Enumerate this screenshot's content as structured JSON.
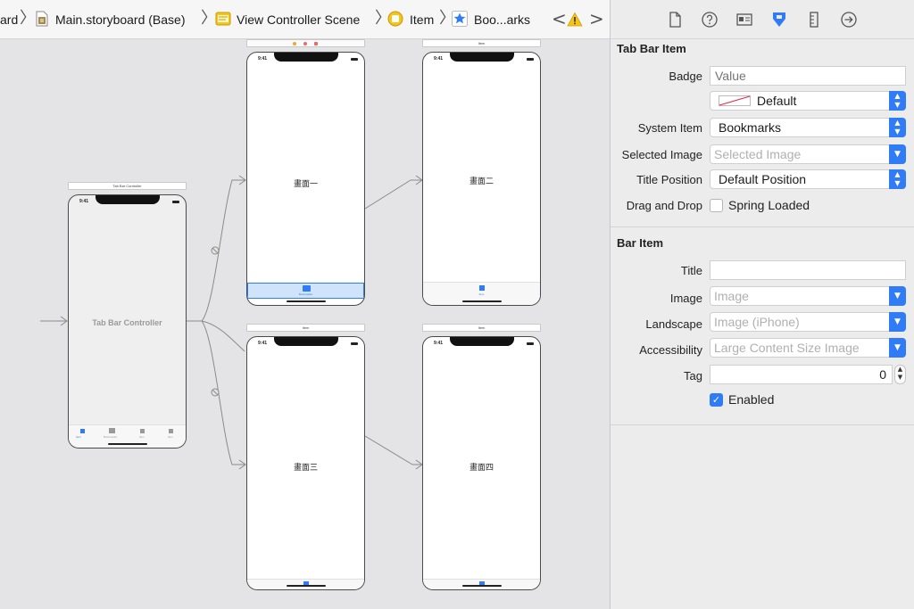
{
  "jumpbar": {
    "crumbs": [
      "ard",
      "Main.storyboard (Base)",
      "View Controller Scene",
      "Item",
      "Boo...arks"
    ],
    "separator": "〉",
    "nav_back": "<",
    "nav_forward": ">",
    "warning_icon": "warning-icon"
  },
  "canvas": {
    "tab_bar_controller": {
      "scene_bar": "Tab Bar Controller",
      "label": "Tab Bar Controller",
      "time": "9:41",
      "tabs": [
        "Item",
        "Bookmarks",
        "Item",
        "Item"
      ]
    },
    "scenes": [
      {
        "bar": "",
        "title": "畫面一",
        "time": "9:41",
        "tab_label": "Bookmarks",
        "selected_tab": true
      },
      {
        "bar": "Item",
        "title": "畫面二",
        "time": "9:41",
        "tab_label": "Item"
      },
      {
        "bar": "Item",
        "title": "畫面三",
        "time": "9:41",
        "tab_label": ""
      },
      {
        "bar": "Item",
        "title": "畫面四",
        "time": "9:41",
        "tab_label": ""
      }
    ]
  },
  "inspector": {
    "tabs": [
      "file-inspector-icon",
      "quick-help-icon",
      "identity-inspector-icon",
      "attributes-inspector-icon",
      "size-inspector-icon",
      "connections-inspector-icon"
    ],
    "tab_bar_item": {
      "title": "Tab Bar Item",
      "badge_label": "Badge",
      "badge_placeholder": "Value",
      "badge_color": "Default",
      "system_item_label": "System Item",
      "system_item_value": "Bookmarks",
      "selected_image_label": "Selected Image",
      "selected_image_placeholder": "Selected Image",
      "title_position_label": "Title Position",
      "title_position_value": "Default Position",
      "drag_drop_label": "Drag and Drop",
      "spring_loaded_label": "Spring Loaded",
      "spring_loaded_checked": false
    },
    "bar_item": {
      "title": "Bar Item",
      "title_label": "Title",
      "title_value": "",
      "image_label": "Image",
      "image_placeholder": "Image",
      "landscape_label": "Landscape",
      "landscape_placeholder": "Image (iPhone)",
      "accessibility_label": "Accessibility",
      "accessibility_placeholder": "Large Content Size Image",
      "tag_label": "Tag",
      "tag_value": "0",
      "enabled_label": "Enabled",
      "enabled_checked": true
    }
  },
  "colors": {
    "accent": "#2f7cf6",
    "canvas_bg": "#e4e4e6",
    "selection": "#cfe3fb",
    "warning": "#f5c518",
    "traffic_light_orange": "#f6a33a",
    "traffic_light_red": "#ef6a5e"
  }
}
